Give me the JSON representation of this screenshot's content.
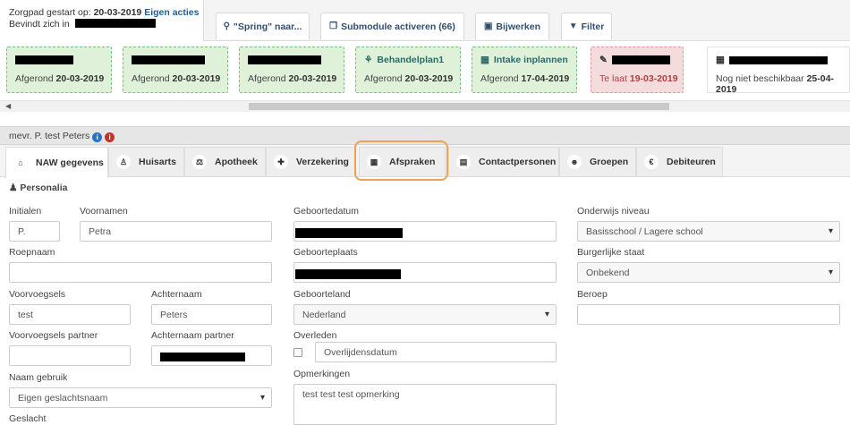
{
  "topbar": {
    "zorgpad_label": "Zorgpad gestart op:",
    "zorgpad_date": "20-03-2019",
    "zorgpad_action": "Eigen acties",
    "location_label": "Bevindt zich in",
    "buttons": [
      {
        "icon": "map-marker-icon",
        "label": "\"Spring\" naar..."
      },
      {
        "icon": "copy-icon",
        "label": "Submodule activeren (66)"
      },
      {
        "icon": "save-icon",
        "label": "Bijwerken"
      },
      {
        "icon": "filter-icon",
        "label": "Filter"
      }
    ]
  },
  "cards": [
    {
      "title": "",
      "status": "Afgerond",
      "date": "20-03-2019",
      "state": "done"
    },
    {
      "title": "",
      "status": "Afgerond",
      "date": "20-03-2019",
      "state": "done"
    },
    {
      "title": "",
      "status": "Afgerond",
      "date": "20-03-2019",
      "state": "done"
    },
    {
      "title": "Behandelplan1",
      "status": "Afgerond",
      "date": "20-03-2019",
      "state": "done"
    },
    {
      "title": "Intake inplannen",
      "status": "Afgerond",
      "date": "17-04-2019",
      "state": "done"
    },
    {
      "title": "",
      "status": "Te laat",
      "date": "19-03-2019",
      "state": "late"
    },
    {
      "title": "",
      "status": "Nog niet beschikbaar",
      "date": "25-04-2019",
      "state": "pending"
    }
  ],
  "patient": {
    "name": "mevr. P. test Peters"
  },
  "tabs": [
    {
      "label": "NAW gegevens",
      "icon": "home-icon"
    },
    {
      "label": "Huisarts",
      "icon": "medic-icon"
    },
    {
      "label": "Apotheek",
      "icon": "scale-icon"
    },
    {
      "label": "Verzekering",
      "icon": "plus-square-icon"
    },
    {
      "label": "Afspraken",
      "icon": "calendar-icon"
    },
    {
      "label": "Contactpersonen",
      "icon": "contact-book-icon"
    },
    {
      "label": "Groepen",
      "icon": "users-icon"
    },
    {
      "label": "Debiteuren",
      "icon": "euro-icon"
    }
  ],
  "section": {
    "title": "Personalia"
  },
  "form": {
    "initialen": {
      "label": "Initialen",
      "value": "P."
    },
    "voornamen": {
      "label": "Voornamen",
      "value": "Petra"
    },
    "roepnaam": {
      "label": "Roepnaam",
      "value": ""
    },
    "voorvoegsels": {
      "label": "Voorvoegsels",
      "value": "test"
    },
    "achternaam": {
      "label": "Achternaam",
      "value": "Peters"
    },
    "voorvoegsels_partner": {
      "label": "Voorvoegsels partner",
      "value": ""
    },
    "achternaam_partner": {
      "label": "Achternaam partner",
      "value": ""
    },
    "naam_gebruik": {
      "label": "Naam gebruik",
      "value": "Eigen geslachtsnaam"
    },
    "geslacht": {
      "label": "Geslacht"
    },
    "geboortedatum": {
      "label": "Geboortedatum",
      "value": ""
    },
    "geboorteplaats": {
      "label": "Geboorteplaats",
      "value": ""
    },
    "geboorteland": {
      "label": "Geboorteland",
      "value": "Nederland"
    },
    "overleden": {
      "label": "Overleden",
      "placeholder": "Overlijdensdatum"
    },
    "opmerkingen": {
      "label": "Opmerkingen",
      "value": "test test test opmerking"
    },
    "onderwijs": {
      "label": "Onderwijs niveau",
      "value": "Basisschool / Lagere school"
    },
    "burgerlijke_staat": {
      "label": "Burgerlijke staat",
      "value": "Onbekend"
    },
    "beroep": {
      "label": "Beroep",
      "value": ""
    }
  },
  "colors": {
    "card_done_bg": "#dff1d8",
    "card_late_bg": "#f5dcdc",
    "highlight": "#f0a050",
    "link": "#1f5f93"
  }
}
